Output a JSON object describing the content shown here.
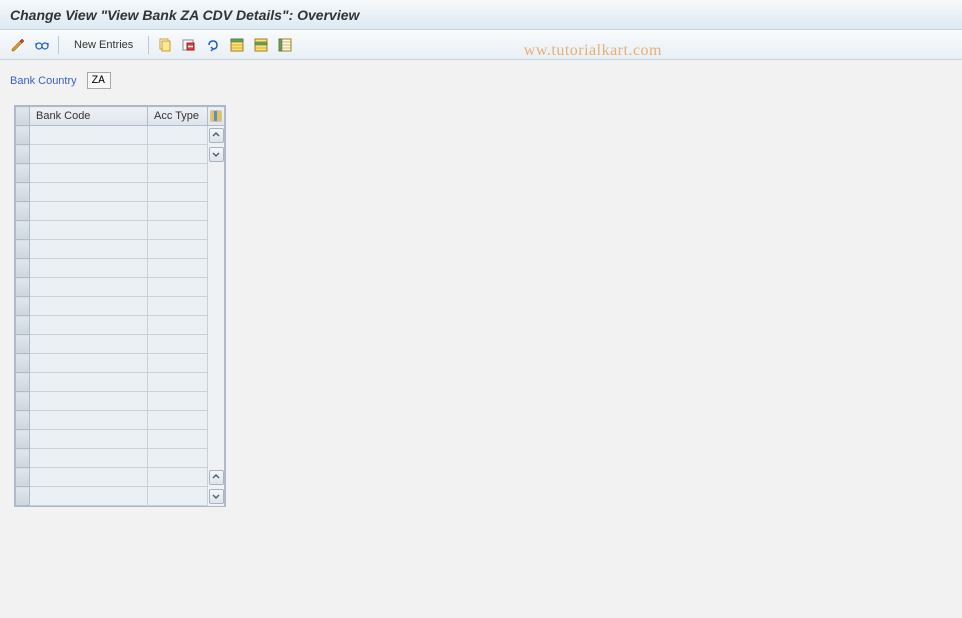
{
  "title": "Change View \"View Bank ZA CDV Details\": Overview",
  "toolbar": {
    "new_entries_label": "New Entries"
  },
  "fields": {
    "bank_country_label": "Bank Country",
    "bank_country_value": "ZA"
  },
  "table": {
    "columns": {
      "bank_code": "Bank Code",
      "acc_type": "Acc Type"
    },
    "rows": [
      {
        "bank_code": "",
        "acc_type": ""
      },
      {
        "bank_code": "",
        "acc_type": ""
      },
      {
        "bank_code": "",
        "acc_type": ""
      },
      {
        "bank_code": "",
        "acc_type": ""
      },
      {
        "bank_code": "",
        "acc_type": ""
      },
      {
        "bank_code": "",
        "acc_type": ""
      },
      {
        "bank_code": "",
        "acc_type": ""
      },
      {
        "bank_code": "",
        "acc_type": ""
      },
      {
        "bank_code": "",
        "acc_type": ""
      },
      {
        "bank_code": "",
        "acc_type": ""
      },
      {
        "bank_code": "",
        "acc_type": ""
      },
      {
        "bank_code": "",
        "acc_type": ""
      },
      {
        "bank_code": "",
        "acc_type": ""
      },
      {
        "bank_code": "",
        "acc_type": ""
      },
      {
        "bank_code": "",
        "acc_type": ""
      },
      {
        "bank_code": "",
        "acc_type": ""
      },
      {
        "bank_code": "",
        "acc_type": ""
      },
      {
        "bank_code": "",
        "acc_type": ""
      },
      {
        "bank_code": "",
        "acc_type": ""
      },
      {
        "bank_code": "",
        "acc_type": ""
      }
    ]
  },
  "watermark": "ww.tutorialkart.com"
}
